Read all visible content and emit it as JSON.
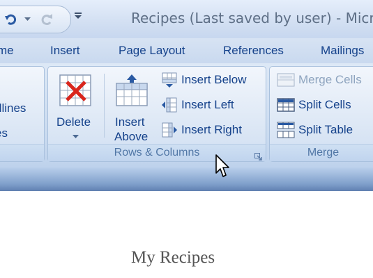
{
  "window": {
    "title": "Recipes (Last saved by user) - Micro"
  },
  "tabs": [
    {
      "label": "me"
    },
    {
      "label": "Insert"
    },
    {
      "label": "Page Layout"
    },
    {
      "label": "References"
    },
    {
      "label": "Mailings"
    }
  ],
  "ribbon": {
    "left_group": {
      "items": [
        "dlines",
        "es"
      ]
    },
    "rows_columns": {
      "label": "Rows & Columns",
      "delete": {
        "label": "Delete"
      },
      "insert_above": {
        "line1": "Insert",
        "line2": "Above"
      },
      "insert_below": {
        "label": "Insert Below"
      },
      "insert_left": {
        "label": "Insert Left"
      },
      "insert_right": {
        "label": "Insert Right"
      }
    },
    "merge": {
      "label": "Merge",
      "merge_cells": {
        "label": "Merge Cells"
      },
      "split_cells": {
        "label": "Split Cells"
      },
      "split_table": {
        "label": "Split Table"
      }
    }
  },
  "document": {
    "title": "My Recipes"
  },
  "colors": {
    "ribbon_text": "#15428b",
    "accent_red": "#d9261c"
  }
}
